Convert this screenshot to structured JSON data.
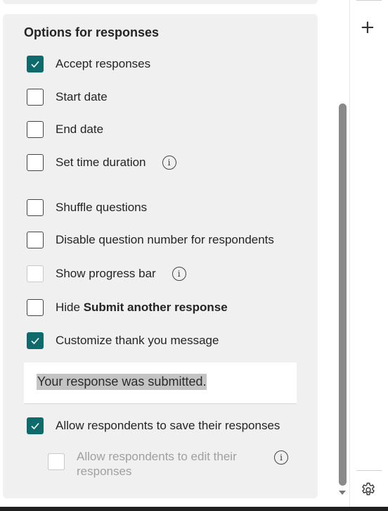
{
  "section_title": "Options for responses",
  "options": [
    {
      "label": "Accept responses",
      "checked": true
    },
    {
      "label": "Start date",
      "checked": false
    },
    {
      "label": "End date",
      "checked": false
    },
    {
      "label": "Set time duration",
      "checked": false,
      "info": true
    },
    {
      "label": "Shuffle questions",
      "checked": false
    },
    {
      "label": "Disable question number for respondents",
      "checked": false
    },
    {
      "label": "Show progress bar",
      "checked": false,
      "info": true
    },
    {
      "label_prefix": "Hide ",
      "label_bold": "Submit another response",
      "checked": false
    },
    {
      "label": "Customize thank you message",
      "checked": true
    },
    {
      "label": "Allow respondents to save their responses",
      "checked": true
    },
    {
      "label_line1": "Allow respondents to edit their",
      "label_line2": "responses",
      "checked": false,
      "disabled": true,
      "info": true
    }
  ],
  "thank_you_message": "Your response was submitted.",
  "info_glyph": "i",
  "check_glyph": "✓",
  "rail": {
    "add_glyph": "+"
  },
  "colors": {
    "accent": "#0f6b6b",
    "panel": "#f0f0f0",
    "disabled": "#a0a0a0"
  }
}
